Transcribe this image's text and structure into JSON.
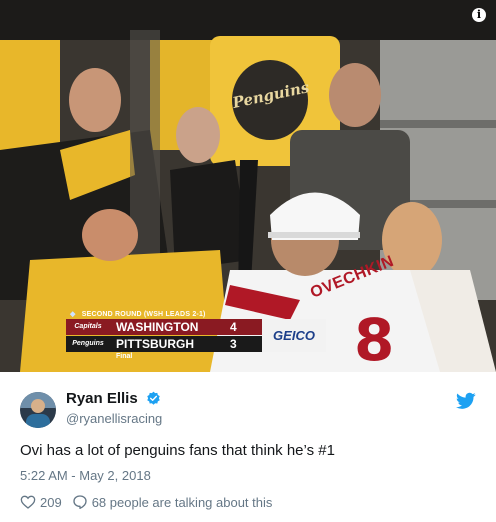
{
  "media": {
    "description_icon": "info-icon",
    "scorebug": {
      "network_icon": "nbc-peacock-icon",
      "header": "SECOND ROUND (WSH LEADS 2-1)",
      "team1": {
        "logo": "Capitals",
        "name": "WASHINGTON",
        "score": "4"
      },
      "team2": {
        "logo": "Penguins",
        "name": "PITTSBURGH",
        "score": "3"
      },
      "status": "Final",
      "sponsor": "GEICO"
    },
    "jersey": {
      "name": "OVECHKIN",
      "number": "8"
    },
    "shirt_text": "Penguins"
  },
  "tweet": {
    "display_name": "Ryan Ellis",
    "handle": "@ryanellisracing",
    "text": "Ovi has a lot of penguins fans that think he’s #1",
    "timestamp": "5:22 AM - May 2, 2018",
    "likes": "209",
    "talking": "68 people are talking about this"
  },
  "colors": {
    "verified": "#1da1f2",
    "bird": "#1da1f2",
    "caps_red": "#8a1a22",
    "muted": "#657786"
  },
  "icons": {
    "verified": "verified-badge-icon",
    "bird": "twitter-bird-icon",
    "like": "heart-icon",
    "reply": "speech-bubble-icon"
  }
}
